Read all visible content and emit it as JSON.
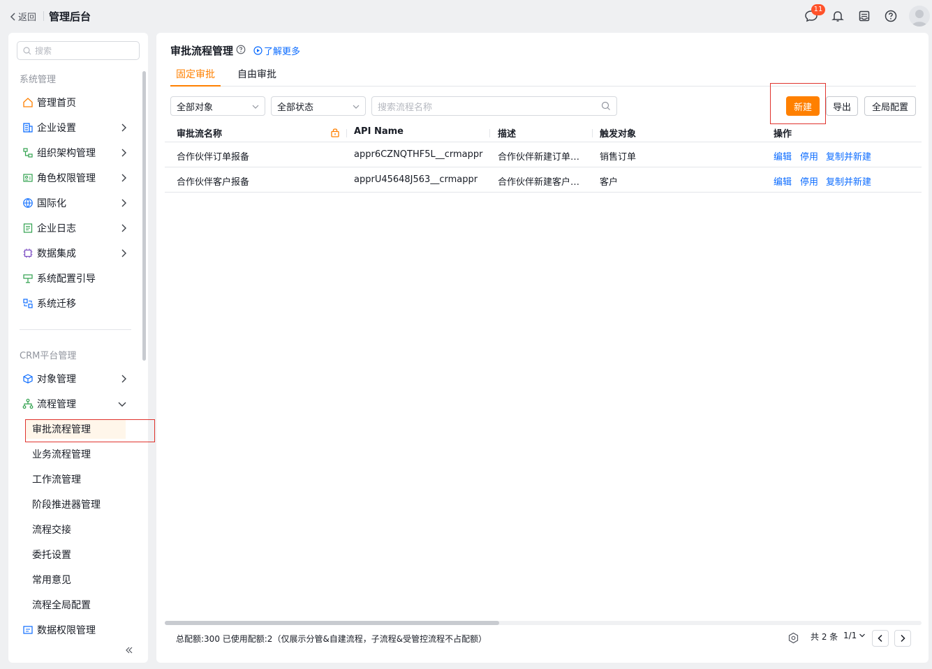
{
  "header": {
    "back_label": "返回",
    "app_title": "管理后台",
    "message_badge": "11"
  },
  "sidebar": {
    "search_placeholder": "搜索",
    "group1_title": "系统管理",
    "group1_items": [
      {
        "label": "管理首页",
        "icon": "home-icon",
        "chevron": false
      },
      {
        "label": "企业设置",
        "icon": "enterprise-icon",
        "chevron": true
      },
      {
        "label": "组织架构管理",
        "icon": "org-icon",
        "chevron": true
      },
      {
        "label": "角色权限管理",
        "icon": "role-icon",
        "chevron": true
      },
      {
        "label": "国际化",
        "icon": "globe-icon",
        "chevron": true
      },
      {
        "label": "企业日志",
        "icon": "log-icon",
        "chevron": true
      },
      {
        "label": "数据集成",
        "icon": "chip-icon",
        "chevron": true
      },
      {
        "label": "系统配置引导",
        "icon": "signpost-icon",
        "chevron": false
      },
      {
        "label": "系统迁移",
        "icon": "migrate-icon",
        "chevron": false
      }
    ],
    "group2_title": "CRM平台管理",
    "group2_items": [
      {
        "label": "对象管理",
        "icon": "cube-icon",
        "chevron": true
      },
      {
        "label": "流程管理",
        "icon": "flow-icon",
        "chevron": true
      }
    ],
    "sub_items": [
      "审批流程管理",
      "业务流程管理",
      "工作流管理",
      "阶段推进器管理",
      "流程交接",
      "委托设置",
      "常用意见",
      "流程全局配置"
    ],
    "cut_item": "数据权限管理",
    "collapse_glyph": "«"
  },
  "main": {
    "title": "审批流程管理",
    "learn_more": "了解更多",
    "tabs": [
      "固定审批",
      "自由审批"
    ],
    "filters": {
      "object": "全部对象",
      "status": "全部状态",
      "search_placeholder": "搜索流程名称"
    },
    "buttons": {
      "new": "新建",
      "export": "导出",
      "global_config": "全局配置"
    },
    "table": {
      "headers": [
        "审批流名称",
        "API Name",
        "描述",
        "触发对象",
        "操作"
      ],
      "rows": [
        {
          "name": "合作伙伴订单报备",
          "api": "appr6CZNQTHF5L__crmappr",
          "desc": "合作伙伴新建订单报备",
          "object": "销售订单",
          "actions": [
            "编辑",
            "停用",
            "复制并新建"
          ]
        },
        {
          "name": "合作伙伴客户报备",
          "api": "apprU45648J563__crmappr",
          "desc": "合作伙伴新建客户报备",
          "object": "客户",
          "actions": [
            "编辑",
            "停用",
            "复制并新建"
          ]
        }
      ]
    },
    "footer": {
      "note": "总配额:300 已使用配额:2（仅展示分管&自建流程，子流程&受管控流程不占配额）",
      "total": "共 2 条",
      "page": "1/1"
    }
  },
  "colors": {
    "accent": "#ff8000",
    "link": "#0c6cff",
    "highlight_box": "#e0332d"
  }
}
